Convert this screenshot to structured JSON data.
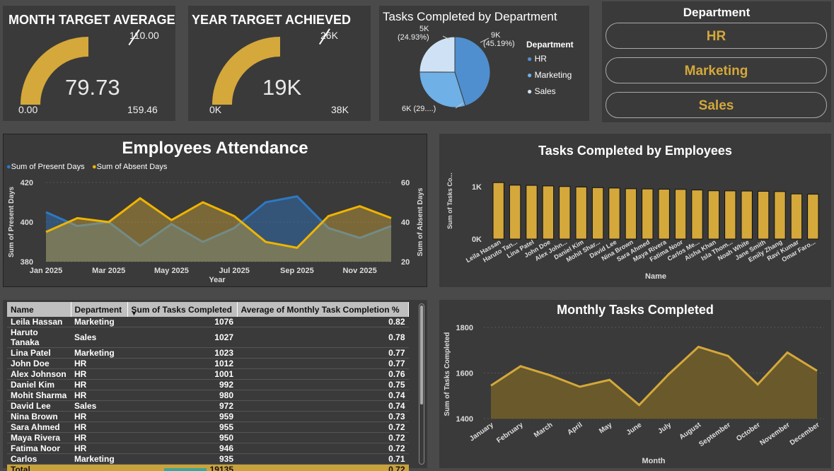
{
  "gauge_month": {
    "title": "MONTH TARGET AVERAGE",
    "value": "79.73",
    "min": "0.00",
    "max": "159.46",
    "target": "110.00",
    "value_num": 79.73,
    "max_num": 159.46
  },
  "gauge_year": {
    "title": "YEAR TARGET ACHIEVED",
    "value": "19K",
    "min": "0K",
    "max": "38K",
    "target": "26K",
    "value_num": 19,
    "max_num": 38
  },
  "pie": {
    "title": "Tasks Completed by Department",
    "legend_title": "Department",
    "legend": [
      "HR",
      "Marketing",
      "Sales"
    ],
    "labels": {
      "hr": "9K",
      "hr_pct": "(45.19%)",
      "mkt": "6K (29....)",
      "sales": "5K",
      "sales_pct": "(24.93%)"
    }
  },
  "slicer": {
    "title": "Department",
    "items": [
      "HR",
      "Marketing",
      "Sales"
    ]
  },
  "attendance": {
    "title": "Employees Attendance",
    "legend": [
      "Sum of Present Days",
      "Sum of Absent Days"
    ],
    "ylabel_left": "Sum of Present Days",
    "ylabel_right": "Sum of Absent Days",
    "xlabel": "Year",
    "yticks_left": [
      "420",
      "400",
      "380"
    ],
    "yticks_right": [
      "60",
      "40",
      "20"
    ],
    "xticks": [
      "Jan 2025",
      "Mar 2025",
      "May 2025",
      "Jul 2025",
      "Sep 2025",
      "Nov 2025"
    ]
  },
  "employees_chart": {
    "title": "Tasks Completed by Employees",
    "ylabel": "Sum of Tasks Co...",
    "xlabel": "Name",
    "yticks": [
      "1K",
      "0K"
    ]
  },
  "monthly": {
    "title": "Monthly Tasks Completed",
    "ylabel": "Sum of Tasks Completed",
    "xlabel": "Month",
    "yticks": [
      "1800",
      "1600",
      "1400"
    ]
  },
  "table": {
    "headers": [
      "Name",
      "Department",
      "Sum of Tasks Completed",
      "Average of Monthly Task Completion %"
    ],
    "rows": [
      [
        "Leila Hassan",
        "Marketing",
        "1076",
        "0.82"
      ],
      [
        "Haruto Tanaka",
        "Sales",
        "1027",
        "0.78"
      ],
      [
        "Lina Patel",
        "Marketing",
        "1023",
        "0.77"
      ],
      [
        "John Doe",
        "HR",
        "1012",
        "0.77"
      ],
      [
        "Alex Johnson",
        "HR",
        "1001",
        "0.76"
      ],
      [
        "Daniel Kim",
        "HR",
        "992",
        "0.75"
      ],
      [
        "Mohit Sharma",
        "HR",
        "980",
        "0.74"
      ],
      [
        "David Lee",
        "Sales",
        "972",
        "0.74"
      ],
      [
        "Nina Brown",
        "HR",
        "959",
        "0.73"
      ],
      [
        "Sara Ahmed",
        "HR",
        "955",
        "0.72"
      ],
      [
        "Maya Rivera",
        "HR",
        "950",
        "0.72"
      ],
      [
        "Fatima Noor",
        "HR",
        "946",
        "0.72"
      ],
      [
        "Carlos",
        "Marketing",
        "935",
        "0.71"
      ]
    ],
    "total": [
      "Total",
      "",
      "19135",
      "0.72"
    ]
  },
  "colors": {
    "gold": "#d4a83a",
    "blue": "#2f78c4",
    "pie_hr": "#4f8fcf",
    "pie_mkt": "#6fb0e6",
    "pie_sales": "#cfe2f5"
  },
  "chart_data": [
    {
      "type": "pie",
      "title": "Tasks Completed by Department",
      "categories": [
        "HR",
        "Marketing",
        "Sales"
      ],
      "values": [
        45.19,
        29.88,
        24.93
      ],
      "labels": [
        "9K",
        "6K",
        "5K"
      ]
    },
    {
      "type": "area",
      "title": "Employees Attendance",
      "x": [
        "Jan 2025",
        "Feb 2025",
        "Mar 2025",
        "Apr 2025",
        "May 2025",
        "Jun 2025",
        "Jul 2025",
        "Aug 2025",
        "Sep 2025",
        "Oct 2025",
        "Nov 2025",
        "Dec 2025"
      ],
      "series": [
        {
          "name": "Sum of Present Days",
          "values": [
            405,
            398,
            400,
            388,
            399,
            390,
            397,
            410,
            413,
            397,
            392,
            398
          ],
          "ylim": [
            380,
            420
          ]
        },
        {
          "name": "Sum of Absent Days",
          "values": [
            35,
            42,
            40,
            52,
            41,
            50,
            43,
            30,
            27,
            43,
            48,
            42
          ],
          "ylim": [
            20,
            60
          ]
        }
      ],
      "xlabel": "Year"
    },
    {
      "type": "bar",
      "title": "Tasks Completed by Employees",
      "categories": [
        "Leila Hassan",
        "Haruto Tan...",
        "Lina Patel",
        "John Doe",
        "Alex John...",
        "Daniel Kim",
        "Mohit Shar...",
        "David Lee",
        "Nina Brown",
        "Sara Ahmed",
        "Maya Rivera",
        "Fatima Noor",
        "Carlos Me...",
        "Aisha Khan",
        "Isla Thom...",
        "Noah White",
        "Jane Smith",
        "Emily Zhang",
        "Ravi Kumar",
        "Omar Faro..."
      ],
      "values": [
        1076,
        1027,
        1023,
        1012,
        1001,
        992,
        980,
        972,
        959,
        955,
        950,
        946,
        935,
        920,
        918,
        915,
        910,
        905,
        860,
        855
      ],
      "ylim": [
        0,
        1200
      ],
      "xlabel": "Name"
    },
    {
      "type": "area",
      "title": "Monthly Tasks Completed",
      "categories": [
        "January",
        "February",
        "March",
        "April",
        "May",
        "June",
        "July",
        "August",
        "September",
        "October",
        "November",
        "December"
      ],
      "values": [
        1545,
        1630,
        1590,
        1540,
        1570,
        1460,
        1595,
        1715,
        1675,
        1550,
        1690,
        1610
      ],
      "ylim": [
        1400,
        1800
      ],
      "xlabel": "Month"
    }
  ]
}
